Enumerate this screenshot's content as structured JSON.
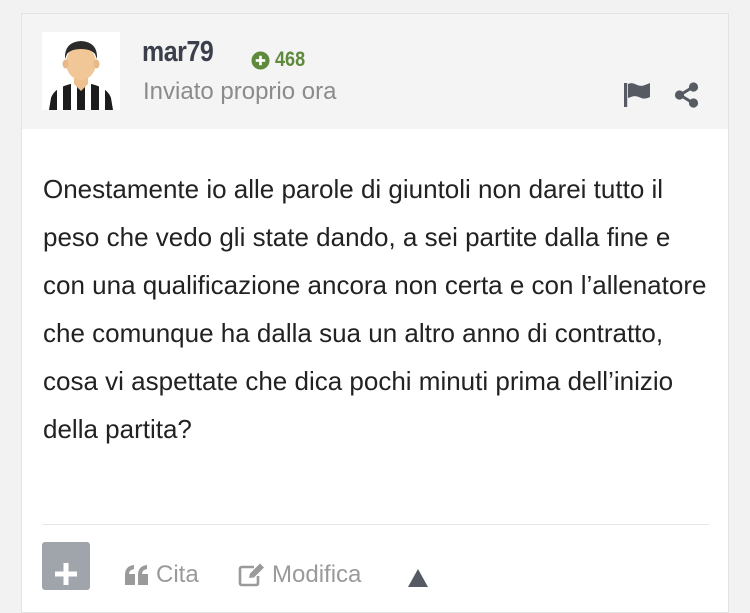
{
  "post": {
    "author": {
      "username": "mar79",
      "reputation": "468",
      "avatar_icon": "juventus-player-avatar-icon"
    },
    "timestamp": "Inviato proprio ora",
    "header_icons": {
      "report": "flag-icon",
      "share": "share-icon"
    },
    "content": "Onestamente io alle parole di giuntoli non darei tutto il peso che vedo gli state dando, a sei partite dalla fine e con una qualificazione ancora non certa e con l’allenatore che comunque ha dalla sua un altro anno di contratto, cosa vi aspettate che dica pochi minuti prima dell’inizio della partita?",
    "actions": {
      "multiquote_icon": "plus-icon",
      "quote_label": "Cita",
      "edit_label": "Modifica",
      "upvote_icon": "triangle-up-icon"
    }
  },
  "colors": {
    "username": "#3a3f4b",
    "reputation": "#5f8a3b",
    "muted_text": "#8b8b8b",
    "header_bg": "#f4f4f4",
    "body_text": "#222222",
    "multiquote_button": "#a0a4ab"
  }
}
